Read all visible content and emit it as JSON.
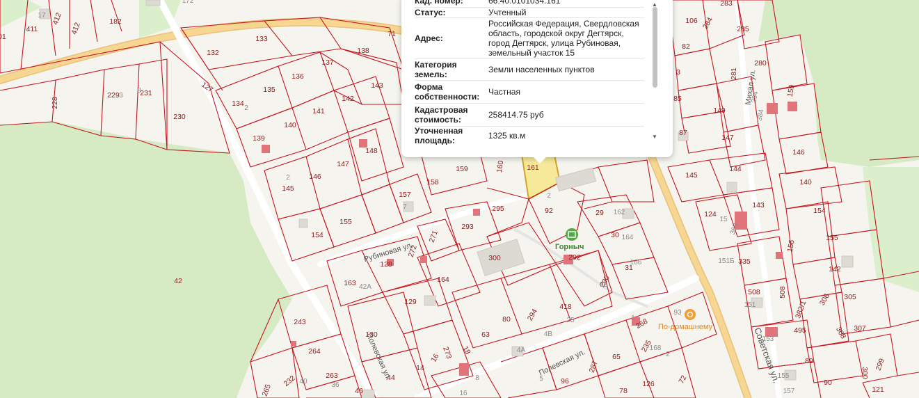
{
  "popup": {
    "rows": [
      {
        "label": "Кад. номер:",
        "value": "66:40:0101034:161"
      },
      {
        "label": "Статус:",
        "value": "Учтенный"
      },
      {
        "label": "Адрес:",
        "value": "Российская Федерация, Свердловская область, городской округ Дегтярск, город Дегтярск, улица Рубиновая, земельный участок 15"
      },
      {
        "label": "Категория земель:",
        "value": "Земли населенных пунктов"
      },
      {
        "label": "Форма собственности:",
        "value": "Частная"
      },
      {
        "label": "Кадастровая стоимость:",
        "value": "258414.75 руб"
      },
      {
        "label": "Уточненная площадь:",
        "value": "1325 кв.м"
      }
    ],
    "scroll_up_glyph": "▲",
    "scroll_down_glyph": "▼"
  },
  "streets": {
    "rubinovaya": "Рубиновая ул.",
    "polevskaya_left": "Полевская ул.",
    "polevskaya_mid": "Полевская ул.",
    "sovetskaya": "Советская ул.",
    "mikhalya": "Михал ул."
  },
  "poi": {
    "gornych": "Горныч",
    "gornych_icon": "grocery-icon",
    "po_domashnemu": "По-домашнему",
    "po_domashnemu_icon": "cafe-icon"
  },
  "plots": {
    "p201": "201",
    "p411": "411",
    "p412a": "412",
    "p412b": "412",
    "p182": "182",
    "p228": "228",
    "p229": "229",
    "p231": "231",
    "p230": "230",
    "p132": "132",
    "p133": "133",
    "p127": "127",
    "p138": "138",
    "p137": "137",
    "p136": "136",
    "p135": "135",
    "p134": "134",
    "p143": "143",
    "p142": "142",
    "p141": "141",
    "p140": "140",
    "p139": "139",
    "p148": "148",
    "p147": "147",
    "p146": "146",
    "p145": "145",
    "p159": "159",
    "p158": "158",
    "p157": "157",
    "p156": "156",
    "p155": "155",
    "p154": "154",
    "p161": "161",
    "p160": "160",
    "p92": "92",
    "p295": "295",
    "p293": "293",
    "p271": "271",
    "p272": "272",
    "p128": "128",
    "p163": "163",
    "p300": "300",
    "p164": "164",
    "p129": "129",
    "p130": "130",
    "p243": "243",
    "p264": "264",
    "p263": "263",
    "p265": "265",
    "p232": "232",
    "p46": "46",
    "p44": "44",
    "p14": "14",
    "p16": "16",
    "p273": "273",
    "p18": "18",
    "p63": "63",
    "p80": "80",
    "p294": "294",
    "p418": "418",
    "p29": "29",
    "p30": "30",
    "p31": "31",
    "p290": "290",
    "p292": "292",
    "p268": "268",
    "p235": "235",
    "p65": "65",
    "p287": "287",
    "p96": "96",
    "p78": "78",
    "p126": "126",
    "p72": "72",
    "p42": "42",
    "p283": "283",
    "p284": "284",
    "p285": "285",
    "p82": "82",
    "p280": "280",
    "p281": "281",
    "p3": "3",
    "p85": "85",
    "p87": "87",
    "p149": "149",
    "p147b": "147",
    "p159b": "159",
    "p146b": "146",
    "p145b": "145",
    "p144": "144",
    "p143b": "143",
    "p124": "124",
    "p140b": "140",
    "p154b": "154",
    "p155b": "155",
    "p335": "335",
    "p142b": "142",
    "p508a": "508",
    "p508b": "508",
    "p382": "382/1",
    "p306": "306",
    "p305": "305",
    "p495": "495",
    "p308": "308",
    "p307": "307",
    "p89": "89",
    "p90": "90",
    "p300b": "300",
    "p299": "299",
    "p121": "121",
    "p106": "106",
    "p71": "71"
  },
  "buildings": {
    "b17": "17",
    "b2a": "2",
    "b2b": "2",
    "b2c": "2",
    "b7": "7",
    "b42A": "42А",
    "b40": "40",
    "b36": "36",
    "b4A": "4А",
    "b4B": "4В",
    "b25": "25",
    "b162": "162",
    "b164": "164",
    "b166": "166",
    "b2B": "2Б",
    "b93": "93",
    "b1": "1",
    "b168": "168",
    "b2d": "2",
    "b8": "8",
    "b5": "5",
    "b3": "3",
    "b15": "15",
    "b363": "363",
    "b384": "384",
    "b151B": "151Б",
    "b151": "151",
    "b153": "153",
    "b155": "155",
    "b157": "157",
    "b294": "294",
    "b8b": "8",
    "b16": "16",
    "b172": "172"
  },
  "colors": {
    "plot_border": "#c8141e",
    "highlight_fill": "#f7e99a",
    "forest": "#d6ebc4",
    "road": "#f7d691"
  }
}
